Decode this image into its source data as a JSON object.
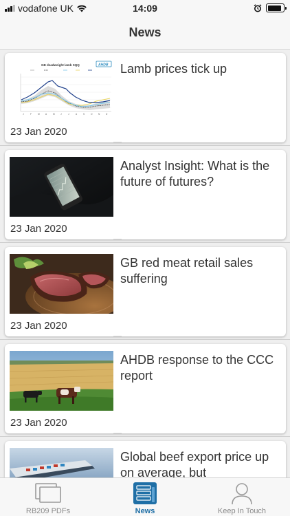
{
  "status_bar": {
    "carrier": "vodafone UK",
    "time": "14:09"
  },
  "header": {
    "title": "News"
  },
  "articles": [
    {
      "headline": "Lamb prices tick up",
      "date": "23 Jan 2020",
      "thumbnail": "chart-thumbnail",
      "thumb_text": {
        "chart_title": "GB deadweight lamb SQQ",
        "brand": "AHDB"
      }
    },
    {
      "headline": "Analyst Insight: What is the future of futures?",
      "date": "23 Jan 2020",
      "thumbnail": "phone-photo"
    },
    {
      "headline": "GB red meat retail sales suffering",
      "date": "23 Jan 2020",
      "thumbnail": "roast-beef-photo"
    },
    {
      "headline": "AHDB response to the CCC report",
      "date": "23 Jan 2020",
      "thumbnail": "cattle-field-photo"
    },
    {
      "headline": "Global beef export price up on average, but",
      "date": "",
      "thumbnail": "ship-photo"
    }
  ],
  "tabs": [
    {
      "label": "RB209 PDFs",
      "icon": "documents-icon",
      "active": false
    },
    {
      "label": "News",
      "icon": "news-icon",
      "active": true
    },
    {
      "label": "Keep In Touch",
      "icon": "person-icon",
      "active": false
    }
  ],
  "colors": {
    "accent": "#1f6fa6",
    "background": "#efefef",
    "card": "#ffffff",
    "text": "#333333",
    "inactive_tab": "#8a8a8a"
  }
}
